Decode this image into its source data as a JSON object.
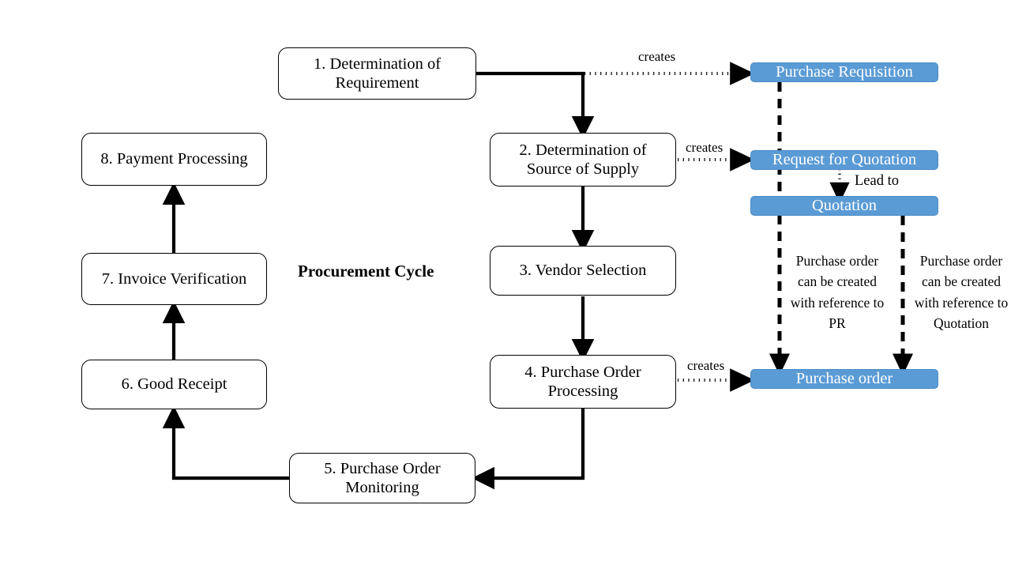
{
  "diagram": {
    "title": "Procurement Cycle",
    "process_steps": [
      {
        "id": "step1",
        "label": "1. Determination of Requirement"
      },
      {
        "id": "step2",
        "label": "2. Determination of Source of Supply"
      },
      {
        "id": "step3",
        "label": "3. Vendor Selection"
      },
      {
        "id": "step4",
        "label": "4. Purchase Order Processing"
      },
      {
        "id": "step5",
        "label": "5. Purchase Order Monitoring"
      },
      {
        "id": "step6",
        "label": "6. Good Receipt"
      },
      {
        "id": "step7",
        "label": "7. Invoice Verification"
      },
      {
        "id": "step8",
        "label": "8. Payment Processing"
      }
    ],
    "documents": [
      {
        "id": "doc_pr",
        "label": "Purchase Requisition"
      },
      {
        "id": "doc_rfq",
        "label": "Request for Quotation"
      },
      {
        "id": "doc_quotation",
        "label": "Quotation"
      },
      {
        "id": "doc_po",
        "label": "Purchase order"
      }
    ],
    "edge_labels": {
      "creates_1": "creates",
      "creates_2": "creates",
      "creates_4": "creates",
      "lead_to": "Lead to"
    },
    "annotations": [
      {
        "id": "note_pr",
        "text": "Purchase order can be created with reference to PR"
      },
      {
        "id": "note_quotation",
        "text": "Purchase order can be created with reference to Quotation"
      }
    ],
    "colors": {
      "document_fill": "#5B9BD5",
      "document_text": "#FFFFFF",
      "process_stroke": "#000000",
      "background": "#FFFFFF"
    }
  }
}
